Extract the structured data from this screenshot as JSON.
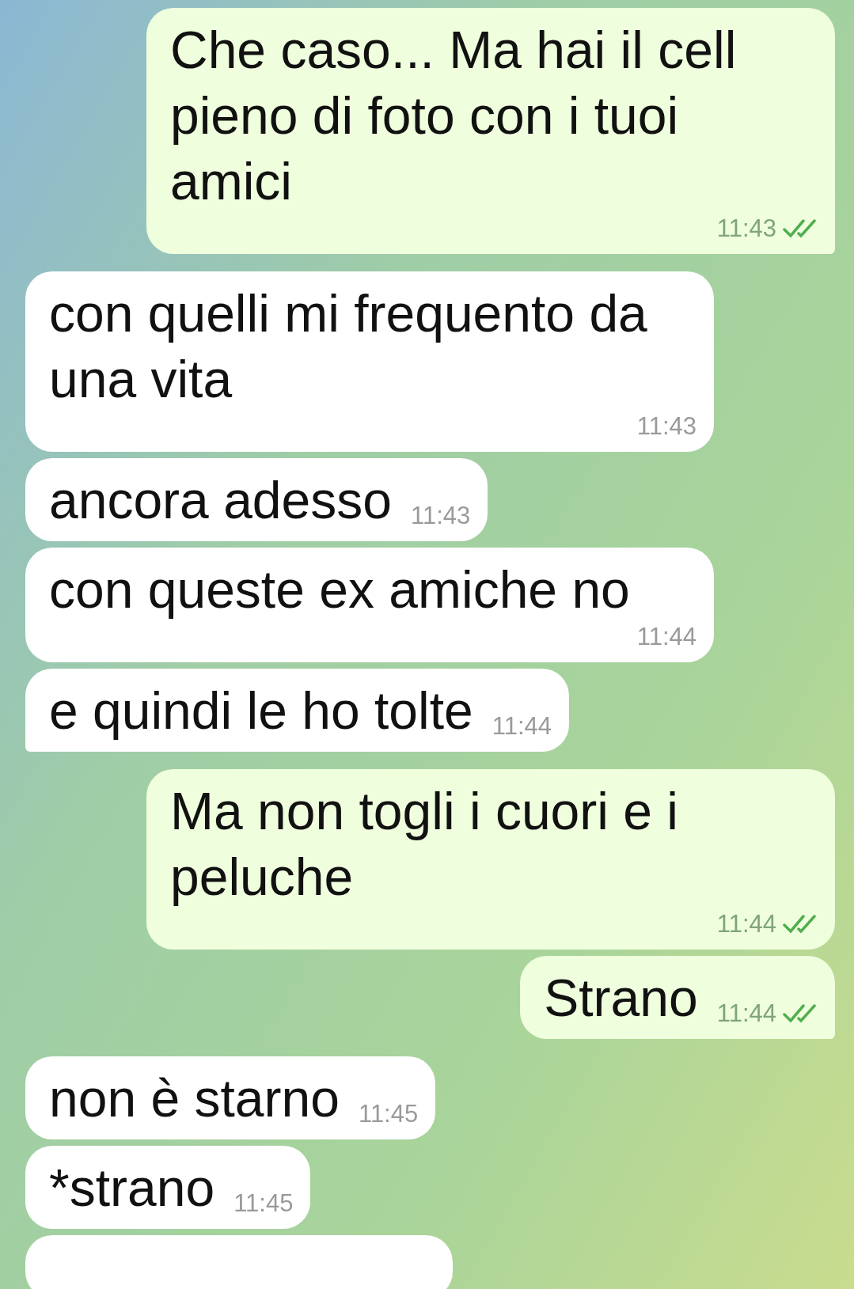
{
  "messages": [
    {
      "kind": "outgoing",
      "text": "Che caso... Ma hai il cell pieno di foto con i tuoi amici",
      "time": "11:43",
      "read": true,
      "tail": true
    },
    {
      "kind": "incoming",
      "text": "con quelli mi frequento da una vita",
      "time": "11:43",
      "tail": false
    },
    {
      "kind": "incoming",
      "text": "ancora adesso",
      "time": "11:43",
      "tail": false
    },
    {
      "kind": "incoming",
      "text": "con queste ex amiche no",
      "time": "11:44",
      "tail": false
    },
    {
      "kind": "incoming",
      "text": "e quindi le ho tolte",
      "time": "11:44",
      "tail": true
    },
    {
      "kind": "outgoing",
      "text": "Ma non togli i cuori e i peluche",
      "time": "11:44",
      "read": true,
      "tail": false
    },
    {
      "kind": "outgoing",
      "text": "Strano",
      "time": "11:44",
      "read": true,
      "tail": true
    },
    {
      "kind": "incoming",
      "text": "non è starno",
      "time": "11:45",
      "tail": false
    },
    {
      "kind": "incoming",
      "text": "*strano",
      "time": "11:45",
      "tail": false
    },
    {
      "kind": "incoming_cut",
      "tail": false
    }
  ]
}
